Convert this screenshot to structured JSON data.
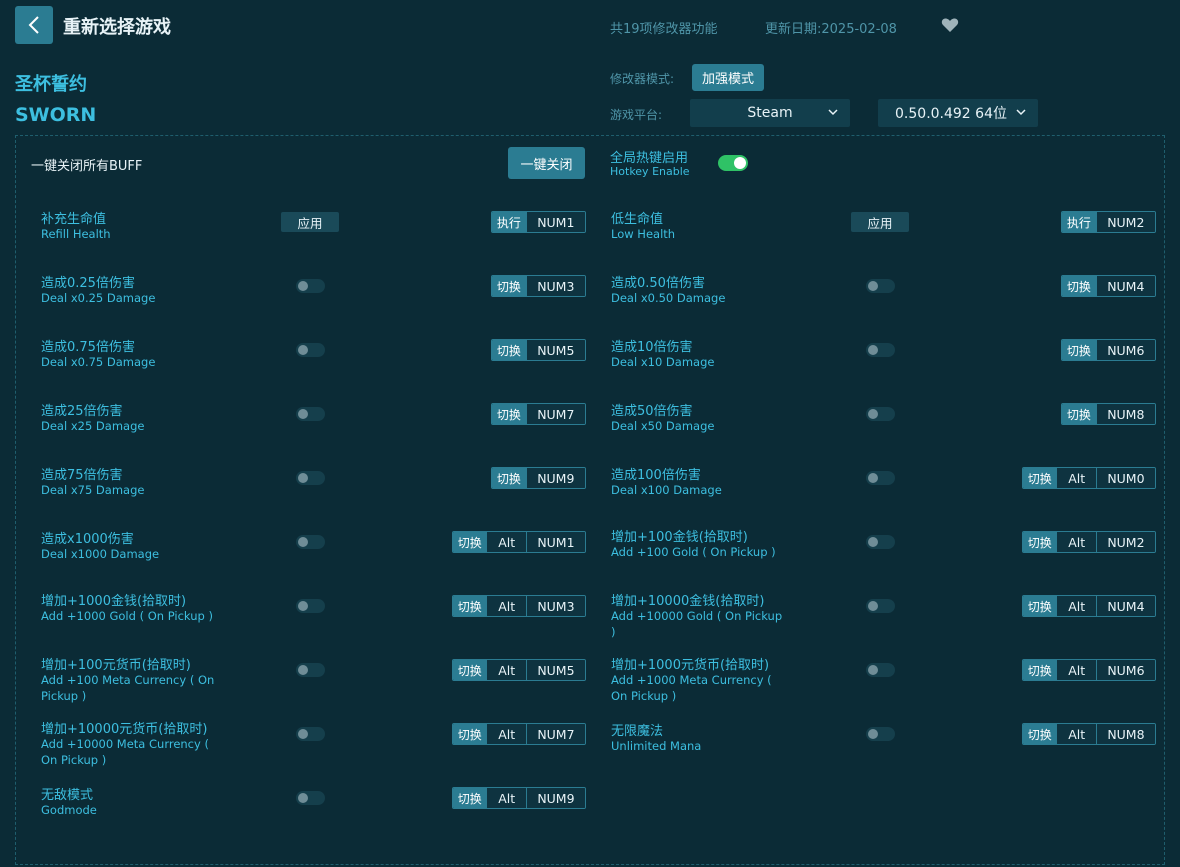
{
  "header": {
    "title": "重新选择游戏",
    "feature_count": "共19项修改器功能",
    "update_date": "更新日期:2025-02-08"
  },
  "game": {
    "name_cn": "圣杯誓约",
    "name_en": "SWORN"
  },
  "mode": {
    "label": "修改器模式:",
    "value": "加强模式"
  },
  "platform": {
    "label": "游戏平台:",
    "value": "Steam",
    "version": "0.50.0.492 64位"
  },
  "panel": {
    "close_all_label": "一键关闭所有BUFF",
    "close_all_button": "一键关闭",
    "hotkey_cn": "全局热键启用",
    "hotkey_en": "Hotkey Enable"
  },
  "labels": {
    "apply": "应用",
    "exec": "执行",
    "toggle": "切换",
    "alt": "Alt"
  },
  "cheats": [
    {
      "cn": "补充生命值",
      "en": "Refill Health",
      "type": "apply",
      "key": "NUM1",
      "alt": false
    },
    {
      "cn": "低生命值",
      "en": "Low Health",
      "type": "apply",
      "key": "NUM2",
      "alt": false
    },
    {
      "cn": "造成0.25倍伤害",
      "en": "Deal x0.25 Damage",
      "type": "toggle",
      "key": "NUM3",
      "alt": false
    },
    {
      "cn": "造成0.50倍伤害",
      "en": "Deal x0.50 Damage",
      "type": "toggle",
      "key": "NUM4",
      "alt": false
    },
    {
      "cn": "造成0.75倍伤害",
      "en": "Deal x0.75 Damage",
      "type": "toggle",
      "key": "NUM5",
      "alt": false
    },
    {
      "cn": "造成10倍伤害",
      "en": "Deal x10 Damage",
      "type": "toggle",
      "key": "NUM6",
      "alt": false
    },
    {
      "cn": "造成25倍伤害",
      "en": "Deal x25 Damage",
      "type": "toggle",
      "key": "NUM7",
      "alt": false
    },
    {
      "cn": "造成50倍伤害",
      "en": "Deal x50 Damage",
      "type": "toggle",
      "key": "NUM8",
      "alt": false
    },
    {
      "cn": "造成75倍伤害",
      "en": "Deal x75 Damage",
      "type": "toggle",
      "key": "NUM9",
      "alt": false
    },
    {
      "cn": "造成100倍伤害",
      "en": "Deal x100 Damage",
      "type": "toggle",
      "key": "NUM0",
      "alt": true
    },
    {
      "cn": "造成x1000伤害",
      "en": "Deal x1000 Damage",
      "type": "toggle",
      "key": "NUM1",
      "alt": true
    },
    {
      "cn": "增加+100金钱(拾取时)",
      "en": "Add +100 Gold ( On Pickup )",
      "type": "toggle",
      "key": "NUM2",
      "alt": true
    },
    {
      "cn": "增加+1000金钱(拾取时)",
      "en": "Add +1000 Gold ( On Pickup )",
      "type": "toggle",
      "key": "NUM3",
      "alt": true
    },
    {
      "cn": "增加+10000金钱(拾取时)",
      "en": "Add +10000 Gold ( On Pickup )",
      "type": "toggle",
      "key": "NUM4",
      "alt": true
    },
    {
      "cn": "增加+100元货币(拾取时)",
      "en": "Add +100 Meta Currency ( On Pickup )",
      "type": "toggle",
      "key": "NUM5",
      "alt": true
    },
    {
      "cn": "增加+1000元货币(拾取时)",
      "en": "Add +1000 Meta Currency ( On Pickup )",
      "type": "toggle",
      "key": "NUM6",
      "alt": true
    },
    {
      "cn": "增加+10000元货币(拾取时)",
      "en": "Add +10000 Meta Currency ( On Pickup )",
      "type": "toggle",
      "key": "NUM7",
      "alt": true
    },
    {
      "cn": "无限魔法",
      "en": "Unlimited Mana",
      "type": "toggle",
      "key": "NUM8",
      "alt": true
    },
    {
      "cn": "无敌模式",
      "en": "Godmode",
      "type": "toggle",
      "key": "NUM9",
      "alt": true
    }
  ]
}
